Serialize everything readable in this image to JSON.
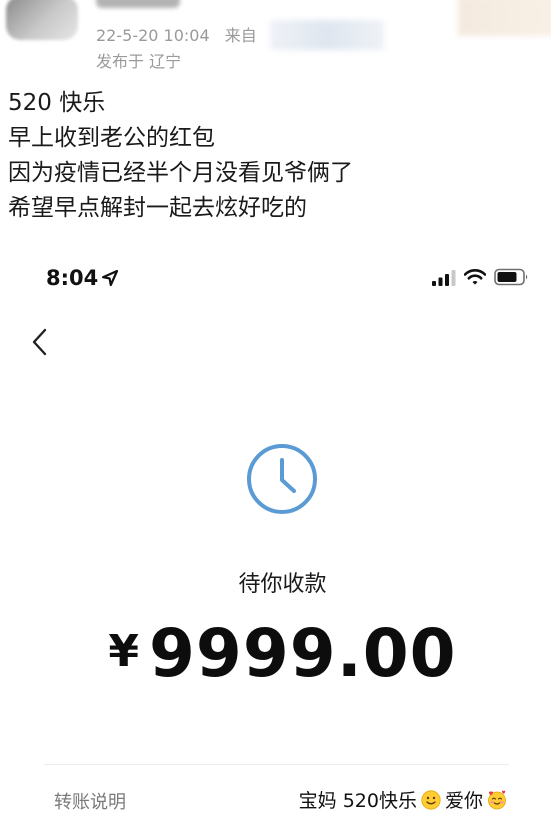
{
  "post": {
    "time": "22-5-20 10:04",
    "source_label": "来自",
    "location": "发布于 辽宁",
    "lines": [
      "520 快乐",
      "早上收到老公的红包",
      "因为疫情已经半个月没看见爷俩了",
      "希望早点解封一起去炫好吃的"
    ]
  },
  "phone": {
    "status_bar": {
      "time": "8:04",
      "icons": [
        "location-arrow-icon",
        "signal-icon",
        "wifi-icon",
        "battery-icon"
      ]
    },
    "back_icon": "chevron-left-icon",
    "status_icon": "clock-icon",
    "status_text": "待你收款",
    "currency": "¥",
    "amount": "9999.00",
    "note": {
      "label": "转账说明",
      "text_before": "宝妈 520快乐",
      "emoji_1": "slightly-smiling-face-icon",
      "text_after": "爱你",
      "emoji_2": "smiling-face-with-hearts-icon"
    },
    "colors": {
      "accent_clock": "#5b9bd5",
      "text_primary": "#111111",
      "text_secondary": "#7a7a7a",
      "meta_gray": "#9a9a9a"
    }
  }
}
